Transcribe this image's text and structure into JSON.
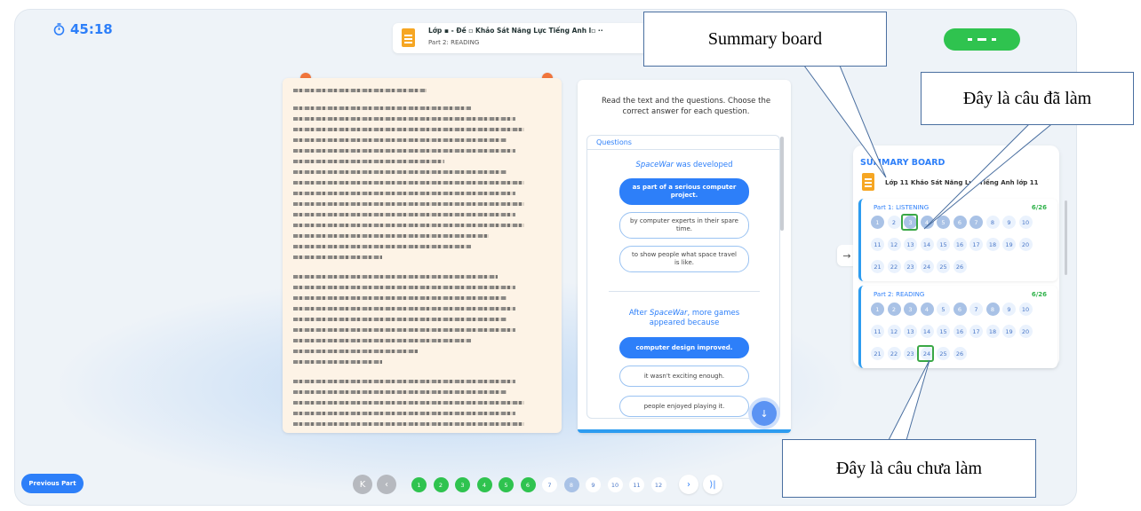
{
  "header": {
    "timer": "45:18",
    "test_title": "Lớp ▪ - Đề ▫ Khảo Sát Năng Lực Tiếng Anh l▫ ··",
    "part_label": "Part 2: READING"
  },
  "instructions": "Read the text and the questions. Choose the correct answer for each question.",
  "questions_heading": "Questions",
  "questions": [
    {
      "prompt_em": "SpaceWar",
      "prompt_rest": " was developed",
      "options": [
        {
          "text": "as part of a serious computer project.",
          "selected": true
        },
        {
          "text": "by computer experts in their spare time.",
          "selected": false
        },
        {
          "text": "to show people what space travel is like.",
          "selected": false
        }
      ]
    },
    {
      "prompt_pre": "After ",
      "prompt_em": "SpaceWar",
      "prompt_rest": ", more games appeared because",
      "options": [
        {
          "text": "computer design improved.",
          "selected": true
        },
        {
          "text": "it wasn't exciting enough.",
          "selected": false
        },
        {
          "text": "people enjoyed playing it.",
          "selected": false
        }
      ]
    }
  ],
  "summary_board": {
    "title": "SUMMARY BOARD",
    "subtitle": "Lớp 11 Khảo Sát Năng Lực Tiếng Anh lớp 11",
    "sections": [
      {
        "name": "Part 1: LISTENING",
        "count": "6/26",
        "answered": [
          1,
          3,
          4,
          5,
          6,
          7
        ]
      },
      {
        "name": "Part 2: READING",
        "count": "6/26",
        "answered": [
          1,
          2,
          3,
          4,
          6,
          8
        ]
      }
    ]
  },
  "nav": {
    "previous_part": "Previous Part",
    "first_icon": "first-page-icon",
    "prev_icon": "chevron-left-icon",
    "next_icon": "chevron-right-icon",
    "last_icon": "last-page-icon",
    "pages": [
      {
        "n": "1",
        "state": "done"
      },
      {
        "n": "2",
        "state": "done"
      },
      {
        "n": "3",
        "state": "done"
      },
      {
        "n": "4",
        "state": "done"
      },
      {
        "n": "5",
        "state": "done"
      },
      {
        "n": "6",
        "state": "done"
      },
      {
        "n": "7",
        "state": "todo"
      },
      {
        "n": "8",
        "state": "current"
      },
      {
        "n": "9",
        "state": "todo"
      },
      {
        "n": "10",
        "state": "todo"
      },
      {
        "n": "11",
        "state": "todo"
      },
      {
        "n": "12",
        "state": "todo"
      }
    ]
  },
  "annotations": {
    "summary_board": "Summary board",
    "answered": "Đây là câu đã làm",
    "unanswered": "Đây là câu chưa làm"
  },
  "colors": {
    "accent": "#2d7ff9",
    "success": "#2fc34f",
    "passage_bg": "#fdf3e6"
  }
}
